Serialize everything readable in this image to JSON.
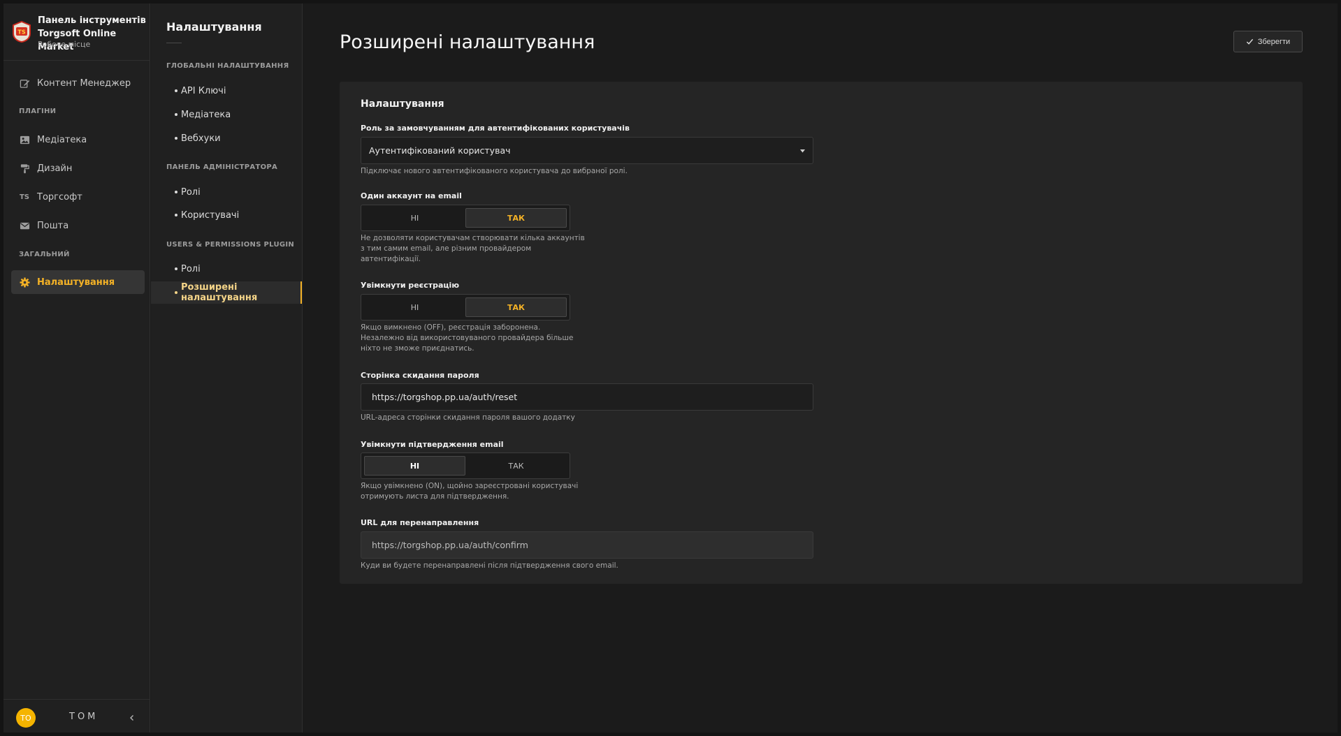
{
  "brand": {
    "title_line1": "Панель інструментів",
    "title_line2": "Torgsoft Online Market",
    "subtitle": "Робоче місце",
    "logo_text": "TS"
  },
  "sidebar": {
    "content_manager": "Контент Менеджер",
    "section_plugins": "ПЛАГІНИ",
    "media": "Медіатека",
    "design": "Дизайн",
    "torgsoft": "Торгсофт",
    "torgsoft_icon_text": "TS",
    "mail": "Пошта",
    "section_general": "ЗАГАЛЬНИЙ",
    "settings": "Налаштування"
  },
  "user": {
    "initials": "TO",
    "name": "TOM"
  },
  "subnav": {
    "title": "Налаштування",
    "section_global": "ГЛОБАЛЬНІ НАЛАШТУВАННЯ",
    "api_keys": "API Ключі",
    "media": "Медіатека",
    "webhooks": "Вебхуки",
    "section_admin": "ПАНЕЛЬ АДМІНІСТРАТОРА",
    "admin_roles": "Ролі",
    "admin_users": "Користувачі",
    "section_plugin": "USERS & PERMISSIONS PLUGIN",
    "plugin_roles": "Ролі",
    "advanced": "Розширені налаштування"
  },
  "header": {
    "title": "Розширені налаштування",
    "save_label": "Зберегти"
  },
  "form": {
    "card_title": "Налаштування",
    "default_role": {
      "label": "Роль за замовчуванням для автентифікованих користувачів",
      "value": "Аутентифікований користувач",
      "help": "Підключає нового автентифікованого користувача до вибраної ролі."
    },
    "one_account": {
      "label": "Один аккаунт на email",
      "no": "НІ",
      "yes": "ТАК",
      "value": "yes",
      "help1": "Не дозволяти користувачам створювати кілька аккаунтів",
      "help2": "з тим самим email, але різним провайдером",
      "help3": "автентифікації."
    },
    "registration": {
      "label": "Увімкнути реєстрацію",
      "no": "НІ",
      "yes": "ТАК",
      "value": "yes",
      "help1": "Якщо вимкнено (OFF), реєстрація заборонена.",
      "help2": "Незалежно від використовуваного провайдера більше",
      "help3": "ніхто не зможе приєднатись."
    },
    "reset_page": {
      "label": "Сторінка скидання пароля",
      "value": "https://torgshop.pp.ua/auth/reset",
      "help": "URL-адреса сторінки скидання пароля вашого додатку"
    },
    "email_confirm": {
      "label": "Увімкнути підтвердження email",
      "no": "НІ",
      "yes": "ТАК",
      "value": "no",
      "help1": "Якщо увімкнено (ON), щойно зареєстровані користувачі",
      "help2": "отримують листа для підтвердження."
    },
    "redirect_url": {
      "label": "URL для перенаправлення",
      "value": "https://torgshop.pp.ua/auth/confirm",
      "help": "Куди ви будете перенаправлені після підтвердження свого email."
    }
  },
  "colors": {
    "accent": "#f4b226",
    "background": "#1b1b1b",
    "panel": "#252525"
  }
}
